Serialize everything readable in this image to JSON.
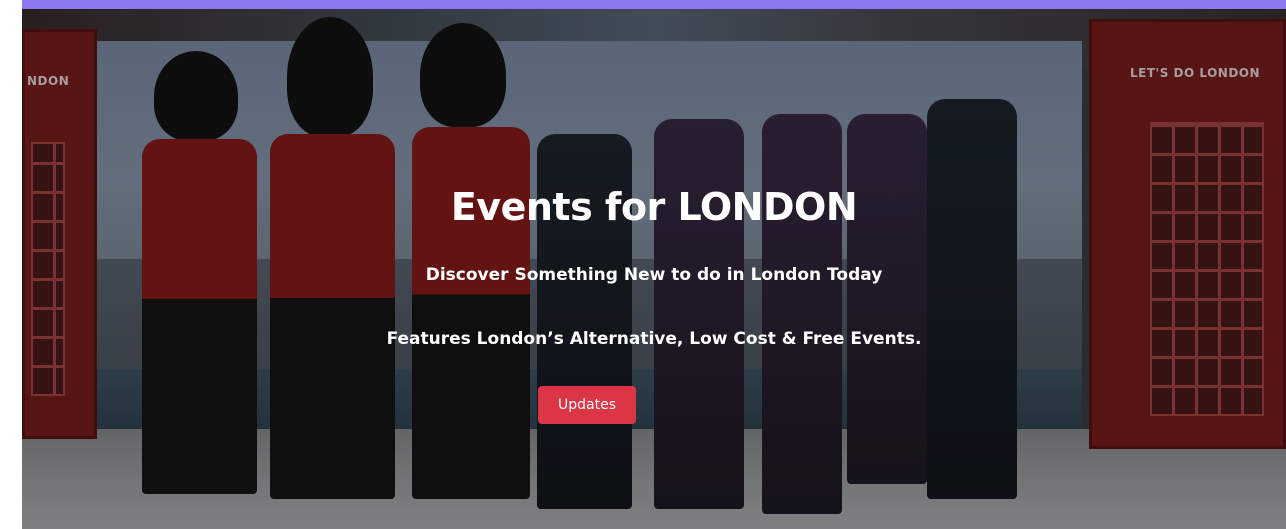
{
  "hero": {
    "title": "Events for LONDON",
    "subtitle": "Discover Something New to do in London Today",
    "tagline": "Features London’s Alternative, Low Cost & Free Events.",
    "button_label": "Updates",
    "booth_sign": "LET'S DO LONDON",
    "booth_sign_left": "NDON"
  },
  "colors": {
    "top_bar": "#8a77f0",
    "button_bg": "#dc3545",
    "text": "#ffffff"
  }
}
